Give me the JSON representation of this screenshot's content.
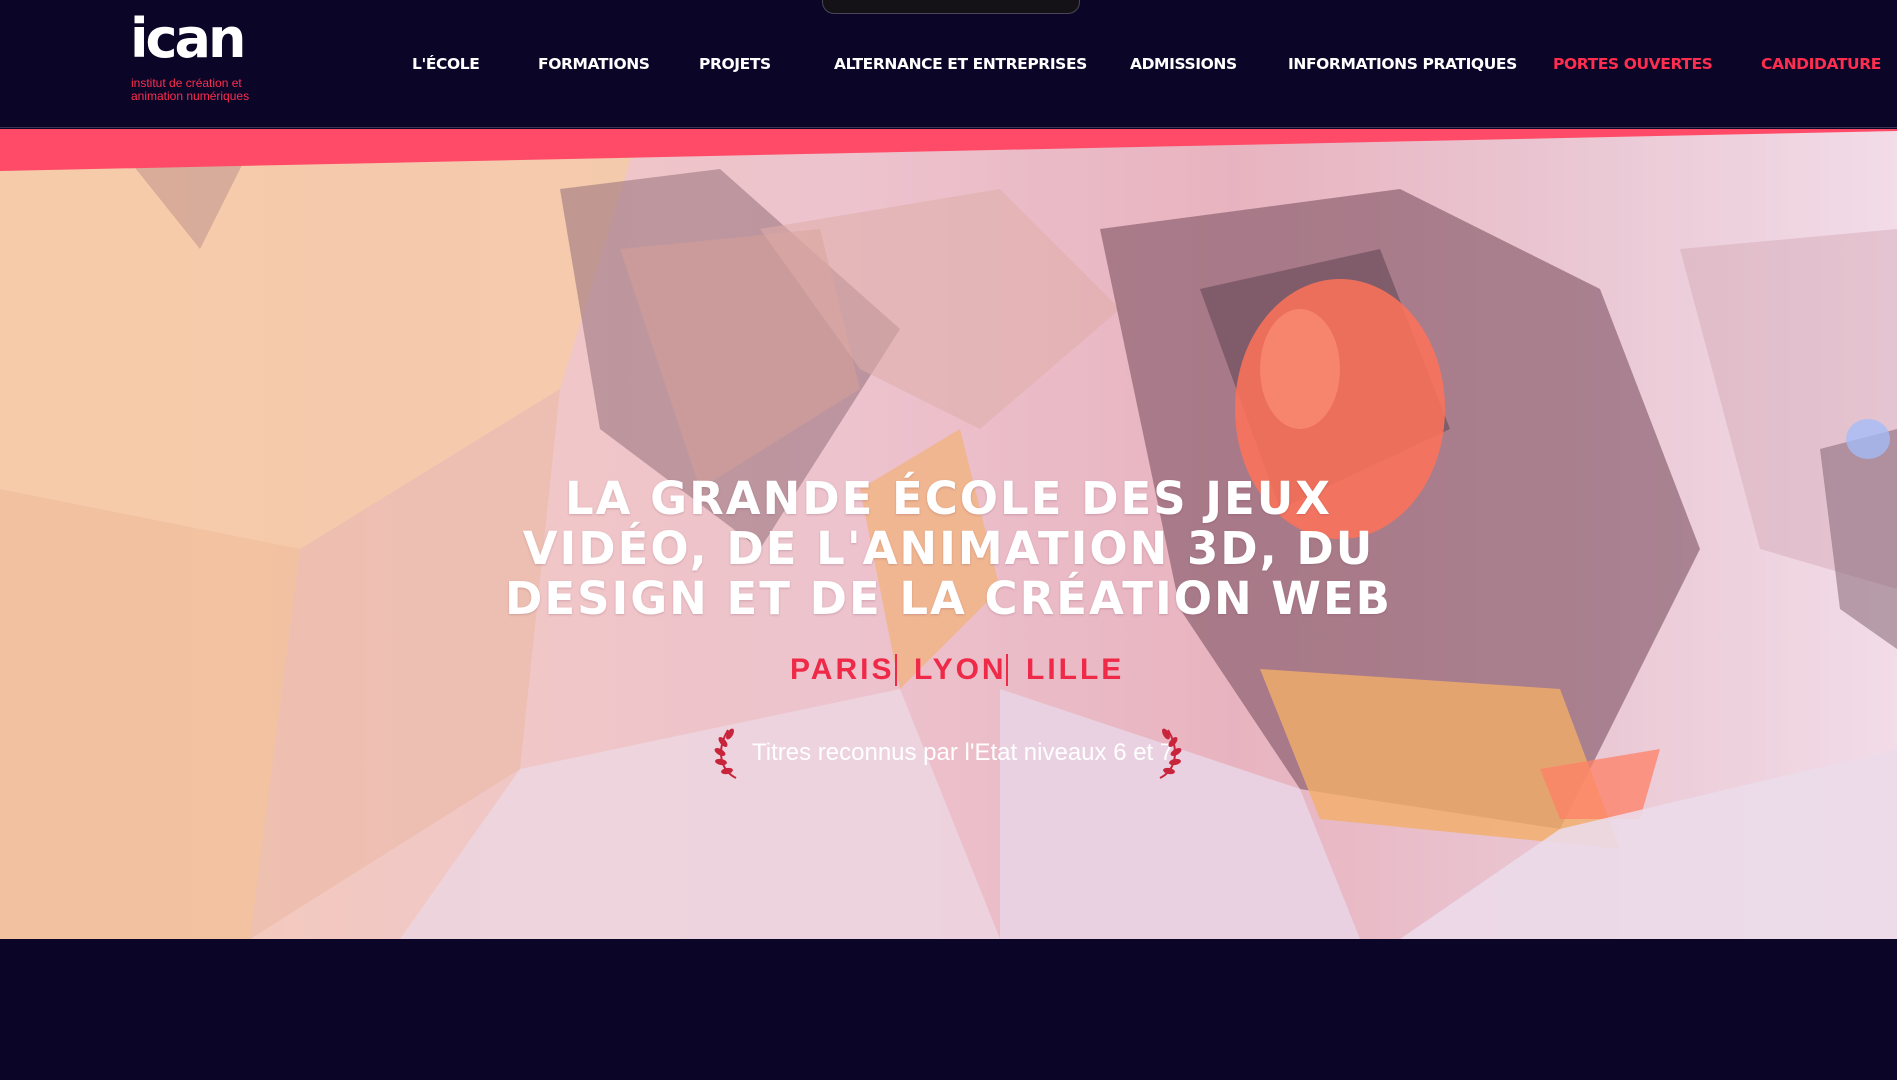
{
  "header": {
    "logo": {
      "wordmark": "ican",
      "tagline_line1": "institut de création et",
      "tagline_line2": "animation numériques"
    },
    "nav": [
      {
        "label": "L'ÉCOLE"
      },
      {
        "label": "FORMATIONS"
      },
      {
        "label": "PROJETS"
      },
      {
        "label": "ALTERNANCE ET ENTREPRISES"
      },
      {
        "label": "ADMISSIONS"
      },
      {
        "label": "INFORMATIONS PRATIQUES"
      },
      {
        "label": "PORTES OUVERTES"
      },
      {
        "label": "CANDIDATURE"
      }
    ]
  },
  "hero": {
    "title_lines": [
      "LA GRANDE ÉCOLE DES JEUX",
      "VIDÉO, DE L'ANIMATION 3D, DU",
      "DESIGN ET DE LA CRÉATION WEB"
    ],
    "cities": [
      "PARIS",
      "LYON",
      "LILLE"
    ],
    "recognition": "Titres reconnus par l'Etat niveaux 6 et 7",
    "laurel_icon": "laurel-wreath-icon"
  },
  "colors": {
    "navy": "#0b0528",
    "accent": "#ff2d4f",
    "white": "#ffffff"
  }
}
